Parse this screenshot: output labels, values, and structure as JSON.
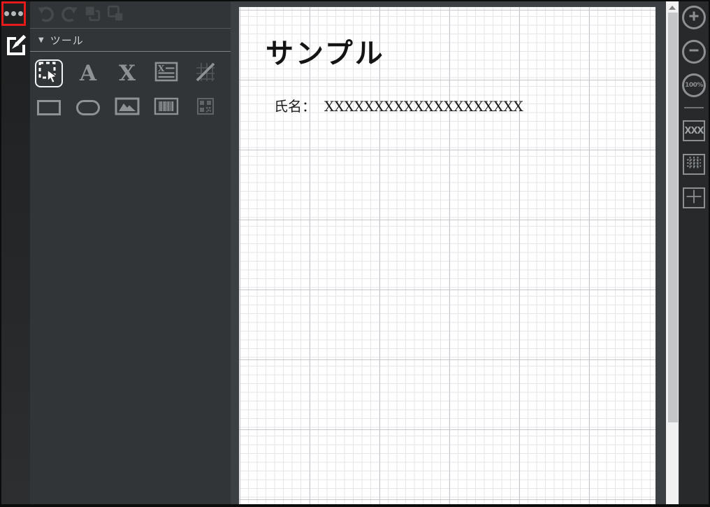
{
  "left_rail": {
    "menu_button": {
      "icon": "ellipsis-menu-icon"
    },
    "highlight": {
      "color": "#e31b1b",
      "note": "red-annotation-box-around-menu-button"
    },
    "edit_button": {
      "icon": "edit-brush-icon"
    }
  },
  "history_toolbar": {
    "buttons": [
      {
        "id": "undo",
        "icon": "undo-arrow-icon",
        "enabled": false
      },
      {
        "id": "redo",
        "icon": "redo-arrow-icon",
        "enabled": false
      },
      {
        "id": "bring-forward",
        "icon": "bring-forward-icon",
        "enabled": false
      },
      {
        "id": "send-backward",
        "icon": "send-backward-icon",
        "enabled": false
      }
    ]
  },
  "tools_panel": {
    "collapse_icon": "▼",
    "section_label": "ツール",
    "tools": [
      {
        "id": "select",
        "icon": "select-cursor-icon",
        "active": true
      },
      {
        "id": "text",
        "icon": "text-tool-icon",
        "glyph": "A"
      },
      {
        "id": "dummy-text",
        "icon": "dummy-text-tool-icon",
        "glyph": "X"
      },
      {
        "id": "text-block",
        "icon": "text-block-tool-icon",
        "glyph": "X"
      },
      {
        "id": "line",
        "icon": "line-grid-tool-icon",
        "enabled": false
      },
      {
        "id": "rectangle",
        "icon": "rectangle-tool-icon"
      },
      {
        "id": "rounded-rectangle",
        "icon": "rounded-rectangle-tool-icon"
      },
      {
        "id": "image",
        "icon": "image-tool-icon"
      },
      {
        "id": "barcode",
        "icon": "barcode-tool-icon"
      },
      {
        "id": "qrcode",
        "icon": "qrcode-tool-icon",
        "enabled": false
      }
    ]
  },
  "canvas": {
    "paper": "grid-paper",
    "title": "サンプル",
    "fields": [
      {
        "label": "氏名：",
        "value": "XXXXXXXXXXXXXXXXXXXX"
      }
    ]
  },
  "right_toolbar": {
    "zoom_in": {
      "icon": "zoom-in-icon"
    },
    "zoom_out": {
      "icon": "zoom-out-icon"
    },
    "zoom_level": "100%",
    "dummy_text_toggle_label": "XXX",
    "grid_toggle": {
      "icon": "grid-toggle-icon"
    },
    "crosshair_toggle": {
      "icon": "crosshair-toggle-icon"
    }
  }
}
